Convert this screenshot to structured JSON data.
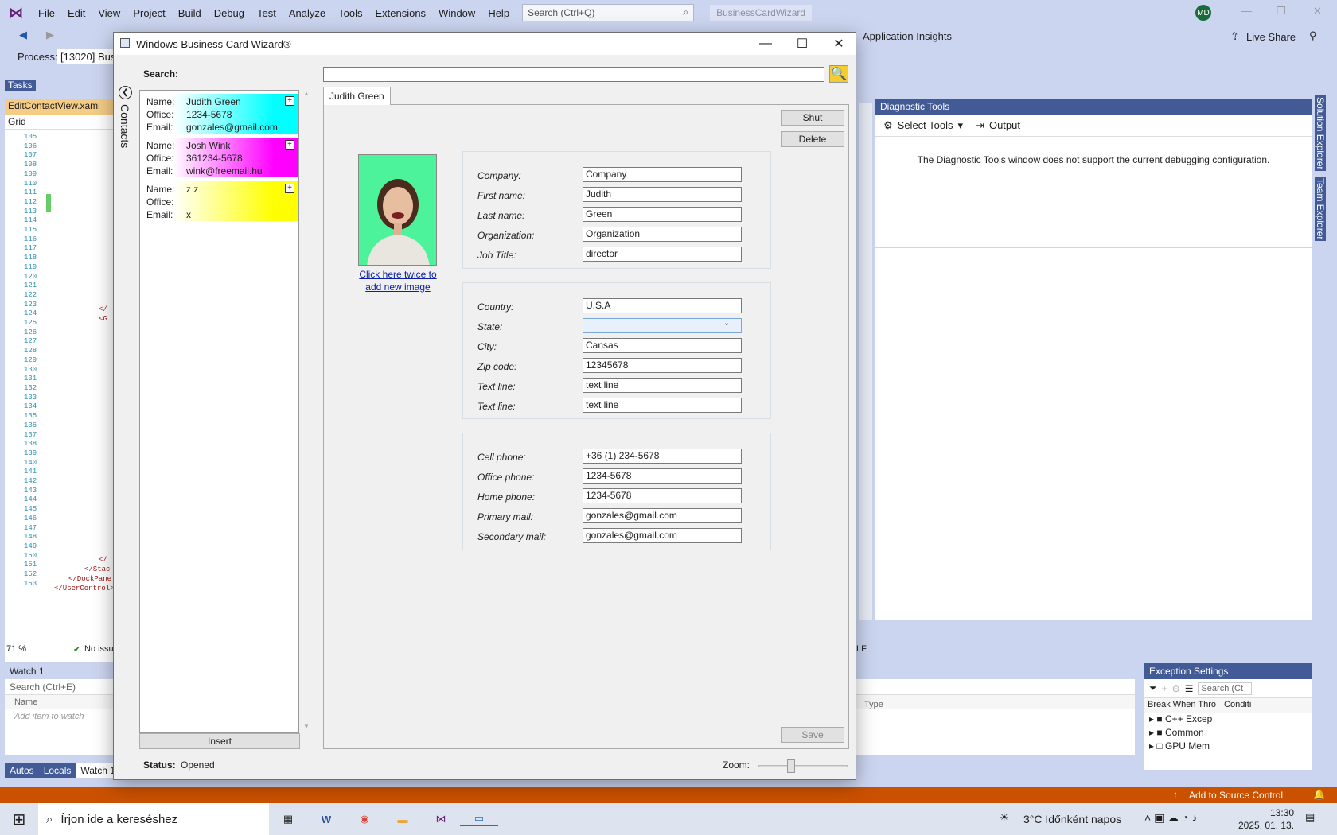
{
  "vs": {
    "menu": [
      "File",
      "Edit",
      "View",
      "Project",
      "Build",
      "Debug",
      "Test",
      "Analyze",
      "Tools",
      "Extensions",
      "Window",
      "Help"
    ],
    "search_placeholder": "Search (Ctrl+Q)",
    "solution_name": "BusinessCardWizard",
    "user_initials": "MD",
    "app_insights": "Application Insights",
    "live_share": "Live Share",
    "process_label": "Process:",
    "process_value": "[13020] Busi",
    "tasks": "Tasks",
    "doc_tab": "EditContactView.xaml",
    "grid_label": "Grid",
    "line_numbers": [
      "105",
      "106",
      "107",
      "108",
      "109",
      "110",
      "111",
      "112",
      "113",
      "114",
      "115",
      "116",
      "117",
      "118",
      "119",
      "120",
      "121",
      "122",
      "123",
      "124",
      "125",
      "126",
      "127",
      "128",
      "129",
      "130",
      "131",
      "132",
      "133",
      "134",
      "135",
      "136",
      "137",
      "138",
      "139",
      "140",
      "141",
      "142",
      "143",
      "144",
      "145",
      "146",
      "147",
      "148",
      "149",
      "150",
      "151",
      "152",
      "153"
    ],
    "code_fragments": [
      "</",
      "<G",
      "</",
      "</Stac",
      "</DockPane",
      "</UserControl>"
    ],
    "zoom": "71 %",
    "no_issues": "No issu",
    "diag_title": "Diagnostic Tools",
    "select_tools": "Select Tools",
    "output": "Output",
    "diag_message": "The Diagnostic Tools window does not support the current debugging configuration.",
    "side_tabs": [
      "Solution Explorer",
      "Team Explorer"
    ],
    "watch_title": "Watch 1",
    "watch_search": "Search (Ctrl+E)",
    "watch_col_name": "Name",
    "watch_col_type": "Type",
    "watch_add": "Add item to watch",
    "bottom_tabs": [
      "Autos",
      "Locals",
      "Watch 1"
    ],
    "exc_title": "Exception Settings",
    "exc_search": "Search (Ct",
    "exc_col1": "Break When Thro",
    "exc_col2": "Conditi",
    "exc_items": [
      "C++ Excep",
      "Common",
      "GPU Mem"
    ],
    "source_control": "Add to Source Control",
    "lf": "LF"
  },
  "wizard": {
    "title": "Windows Business Card Wizard®",
    "search_label": "Search:",
    "side_tab": "Contacts",
    "cards": [
      {
        "name_label": "Name:",
        "name": "Judith Green",
        "office_label": "Office:",
        "office": " 1234-5678",
        "email_label": "Email:",
        "email": "gonzales@gmail.com",
        "color": "#00ffff"
      },
      {
        "name_label": "Name:",
        "name": "Josh Wink",
        "office_label": "Office:",
        "office": " 361234-5678",
        "email_label": "Email:",
        "email": "wink@freemail.hu",
        "color": "#ff00ff"
      },
      {
        "name_label": "Name:",
        "name": "z z",
        "office_label": "Office:",
        "office": "",
        "email_label": "Email:",
        "email": "x",
        "color": "#ffff00"
      }
    ],
    "insert": "Insert",
    "tab": "Judith Green",
    "shut": "Shut",
    "delete": "Delete",
    "image_link_1": "Click here twice to",
    "image_link_2": "add new image",
    "fields1": [
      {
        "label": "Company:",
        "value": "Company"
      },
      {
        "label": "First name:",
        "value": "Judith"
      },
      {
        "label": "Last name:",
        "value": "Green"
      },
      {
        "label": "Organization:",
        "value": "Organization"
      },
      {
        "label": "Job Title:",
        "value": "director"
      }
    ],
    "fields2": [
      {
        "label": "Country:",
        "value": "U.S.A"
      },
      {
        "label": "State:",
        "value": ""
      },
      {
        "label": "City:",
        "value": "Cansas"
      },
      {
        "label": "Zip code:",
        "value": "12345678"
      },
      {
        "label": "Text line:",
        "value": "text line"
      },
      {
        "label": "Text line:",
        "value": "text line"
      }
    ],
    "fields3": [
      {
        "label": "Cell phone:",
        "value": "+36 (1) 234-5678"
      },
      {
        "label": "Office phone:",
        "value": " 1234-5678"
      },
      {
        "label": "Home phone:",
        "value": " 1234-5678"
      },
      {
        "label": "Primary mail:",
        "value": "gonzales@gmail.com"
      },
      {
        "label": "Secondary mail:",
        "value": "gonzales@gmail.com"
      }
    ],
    "save": "Save",
    "status_label": "Status:",
    "status_value": "Opened",
    "zoom_label": "Zoom:"
  },
  "taskbar": {
    "search": "Írjon ide a kereséshez",
    "weather": "3°C  Időnként napos",
    "time": "13:30",
    "date": "2025. 01. 13."
  }
}
